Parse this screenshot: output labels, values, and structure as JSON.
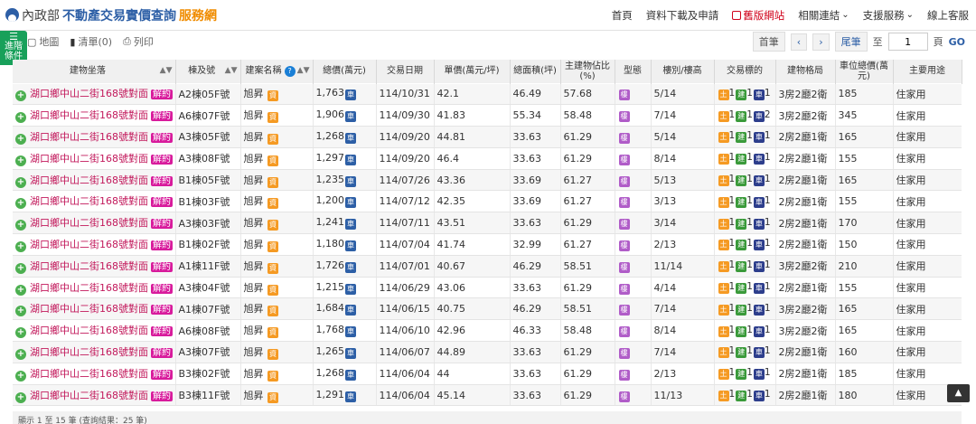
{
  "header": {
    "ministry": "內政部",
    "title_main": "不動產交易實價查詢",
    "title_accent": "服務網",
    "nav": [
      "首頁",
      "資料下載及申請",
      "舊版網站",
      "相關連結",
      "支援服務",
      "線上客服"
    ]
  },
  "filter_tab": {
    "label1": "進階",
    "label2": "條件"
  },
  "toolbar": {
    "map": "地圖",
    "list": "清單(0)",
    "print": "列印"
  },
  "pager": {
    "first": "首筆",
    "prev": "‹",
    "next": "›",
    "last": "尾筆",
    "to": "至",
    "page_value": "1",
    "page_unit": "頁",
    "go": "GO"
  },
  "columns": [
    "建物坐落",
    "棟及號",
    "建案名稱",
    "總價(萬元)",
    "交易日期",
    "單價(萬元/坪)",
    "總面積(坪)",
    "主建物佔比(%)",
    "型態",
    "樓別/樓高",
    "交易標的",
    "建物格局",
    "車位總價(萬元)",
    "主要用途"
  ],
  "common": {
    "address": "湖口鄉中山二街168號對面",
    "contract": "解約",
    "project": "旭昇",
    "project_tag": "資",
    "price_tag": "車",
    "type_tag": "樓",
    "land": "土",
    "building": "建",
    "parking": "車",
    "use": "住家用"
  },
  "rows": [
    {
      "unit": "A2棟05F號",
      "price": "1,763",
      "date": "114/10/31",
      "unit_price": "42.1",
      "area": "46.49",
      "ratio": "57.68",
      "floor": "5/14",
      "l": "1",
      "b": "1",
      "p": "1",
      "layout": "3房2廳2衛",
      "parking_price": "185"
    },
    {
      "unit": "A6棟07F號",
      "price": "1,906",
      "date": "114/09/30",
      "unit_price": "41.83",
      "area": "55.34",
      "ratio": "58.48",
      "floor": "7/14",
      "l": "1",
      "b": "1",
      "p": "2",
      "layout": "3房2廳2衛",
      "parking_price": "345"
    },
    {
      "unit": "A3棟05F號",
      "price": "1,268",
      "date": "114/09/20",
      "unit_price": "44.81",
      "area": "33.63",
      "ratio": "61.29",
      "floor": "5/14",
      "l": "1",
      "b": "1",
      "p": "1",
      "layout": "2房2廳1衛",
      "parking_price": "165"
    },
    {
      "unit": "A3棟08F號",
      "price": "1,297",
      "date": "114/09/20",
      "unit_price": "46.4",
      "area": "33.63",
      "ratio": "61.29",
      "floor": "8/14",
      "l": "1",
      "b": "1",
      "p": "1",
      "layout": "2房2廳1衛",
      "parking_price": "155"
    },
    {
      "unit": "B1棟05F號",
      "price": "1,235",
      "date": "114/07/26",
      "unit_price": "43.36",
      "area": "33.69",
      "ratio": "61.27",
      "floor": "5/13",
      "l": "1",
      "b": "1",
      "p": "1",
      "layout": "2房2廳1衛",
      "parking_price": "165"
    },
    {
      "unit": "B1棟03F號",
      "price": "1,200",
      "date": "114/07/12",
      "unit_price": "42.35",
      "area": "33.69",
      "ratio": "61.27",
      "floor": "3/13",
      "l": "1",
      "b": "1",
      "p": "1",
      "layout": "2房2廳1衛",
      "parking_price": "155"
    },
    {
      "unit": "A3棟03F號",
      "price": "1,241",
      "date": "114/07/11",
      "unit_price": "43.51",
      "area": "33.63",
      "ratio": "61.29",
      "floor": "3/14",
      "l": "1",
      "b": "1",
      "p": "1",
      "layout": "2房2廳1衛",
      "parking_price": "170"
    },
    {
      "unit": "B1棟02F號",
      "price": "1,180",
      "date": "114/07/04",
      "unit_price": "41.74",
      "area": "32.99",
      "ratio": "61.27",
      "floor": "2/13",
      "l": "1",
      "b": "1",
      "p": "1",
      "layout": "2房2廳1衛",
      "parking_price": "150"
    },
    {
      "unit": "A1棟11F號",
      "price": "1,726",
      "date": "114/07/01",
      "unit_price": "40.67",
      "area": "46.29",
      "ratio": "58.51",
      "floor": "11/14",
      "l": "1",
      "b": "1",
      "p": "1",
      "layout": "3房2廳2衛",
      "parking_price": "210"
    },
    {
      "unit": "A3棟04F號",
      "price": "1,215",
      "date": "114/06/29",
      "unit_price": "43.06",
      "area": "33.63",
      "ratio": "61.29",
      "floor": "4/14",
      "l": "1",
      "b": "1",
      "p": "1",
      "layout": "2房2廳1衛",
      "parking_price": "155"
    },
    {
      "unit": "A1棟07F號",
      "price": "1,684",
      "date": "114/06/15",
      "unit_price": "40.75",
      "area": "46.29",
      "ratio": "58.51",
      "floor": "7/14",
      "l": "1",
      "b": "1",
      "p": "1",
      "layout": "3房2廳2衛",
      "parking_price": "165"
    },
    {
      "unit": "A6棟08F號",
      "price": "1,768",
      "date": "114/06/10",
      "unit_price": "42.96",
      "area": "46.33",
      "ratio": "58.48",
      "floor": "8/14",
      "l": "1",
      "b": "1",
      "p": "1",
      "layout": "3房2廳2衛",
      "parking_price": "165"
    },
    {
      "unit": "A3棟07F號",
      "price": "1,265",
      "date": "114/06/07",
      "unit_price": "44.89",
      "area": "33.63",
      "ratio": "61.29",
      "floor": "7/14",
      "l": "1",
      "b": "1",
      "p": "1",
      "layout": "2房2廳1衛",
      "parking_price": "160"
    },
    {
      "unit": "B3棟02F號",
      "price": "1,268",
      "date": "114/06/04",
      "unit_price": "44",
      "area": "33.63",
      "ratio": "61.29",
      "floor": "2/13",
      "l": "1",
      "b": "1",
      "p": "1",
      "layout": "2房2廳1衛",
      "parking_price": "185"
    },
    {
      "unit": "B3棟11F號",
      "price": "1,291",
      "date": "114/06/04",
      "unit_price": "45.14",
      "area": "33.63",
      "ratio": "61.29",
      "floor": "11/13",
      "l": "1",
      "b": "1",
      "p": "1",
      "layout": "2房2廳1衛",
      "parking_price": "180"
    }
  ],
  "footer": "顯示 1 至 15 筆 (查詢結果：25 筆)"
}
